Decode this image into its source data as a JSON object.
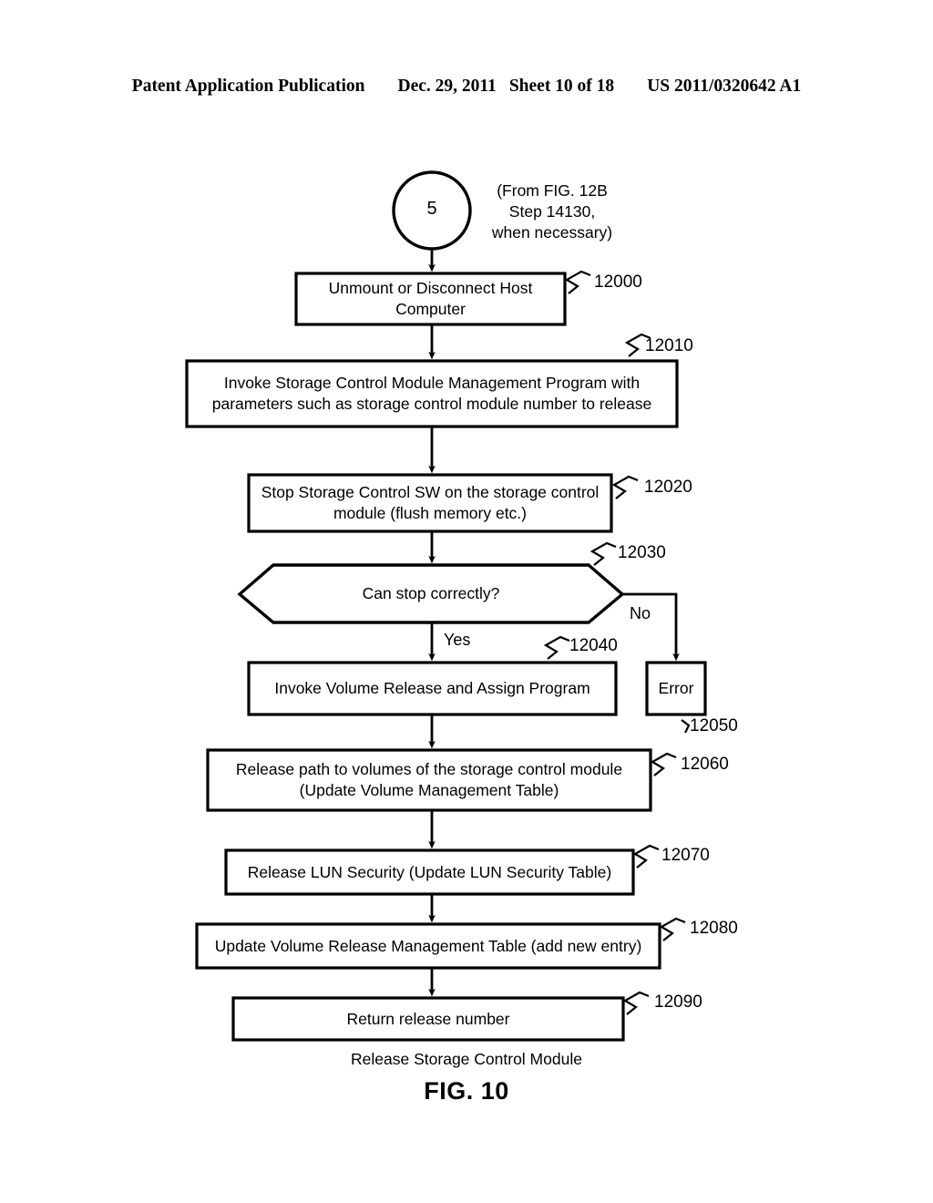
{
  "header": {
    "publication": "Patent Application Publication",
    "date": "Dec. 29, 2011",
    "sheet": "Sheet 10 of 18",
    "number": "US 2011/0320642 A1"
  },
  "figure": {
    "caption": "Release Storage Control Module",
    "label": "FIG. 10"
  },
  "connector": {
    "number": "5",
    "note": "(From FIG. 12B\nStep 14130,\nwhen necessary)"
  },
  "branches": {
    "yes": "Yes",
    "no": "No"
  },
  "nodes": [
    {
      "id": "n12000",
      "ref": "12000",
      "type": "process",
      "text": "Unmount or Disconnect Host Computer"
    },
    {
      "id": "n12010",
      "ref": "12010",
      "type": "process",
      "text": "Invoke Storage Control Module Management Program with parameters such as storage control module number to release"
    },
    {
      "id": "n12020",
      "ref": "12020",
      "type": "process",
      "text": "Stop Storage Control SW on the storage control module (flush memory etc.)"
    },
    {
      "id": "n12030",
      "ref": "12030",
      "type": "decision",
      "text": "Can stop correctly?"
    },
    {
      "id": "n12040",
      "ref": "12040",
      "type": "process",
      "text": "Invoke Volume Release and Assign Program"
    },
    {
      "id": "n12050",
      "ref": "12050",
      "type": "process",
      "text": "Error"
    },
    {
      "id": "n12060",
      "ref": "12060",
      "type": "process",
      "text": "Release path to volumes of the storage control module (Update Volume Management Table)"
    },
    {
      "id": "n12070",
      "ref": "12070",
      "type": "process",
      "text": "Release LUN Security (Update LUN Security Table)"
    },
    {
      "id": "n12080",
      "ref": "12080",
      "type": "process",
      "text": "Update Volume Release Management Table (add new entry)"
    },
    {
      "id": "n12090",
      "ref": "12090",
      "type": "process",
      "text": "Return release number"
    }
  ],
  "colors": {
    "ink": "#000000",
    "paper": "#ffffff"
  }
}
